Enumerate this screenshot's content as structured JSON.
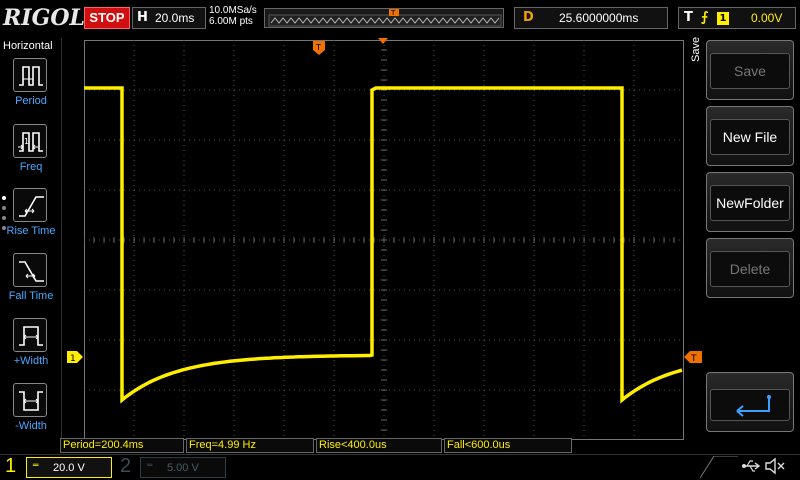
{
  "header": {
    "logo": "RIGOL",
    "run_state": "STOP",
    "timebase": {
      "key": "H",
      "value": "20.0ms"
    },
    "sample_rate": "10.0MSa/s",
    "memory_depth": "6.00M pts",
    "delay": {
      "key": "D",
      "value": "25.6000000ms"
    },
    "trigger": {
      "key": "T",
      "edge_icon": "rising-edge-icon",
      "source": "1",
      "level": "0.00V"
    }
  },
  "left_menu": {
    "title": "Horizontal",
    "items": [
      {
        "label": "Period",
        "icon": "period-icon"
      },
      {
        "label": "Freq",
        "icon": "frequency-icon"
      },
      {
        "label": "Rise Time",
        "icon": "rise-time-icon"
      },
      {
        "label": "Fall Time",
        "icon": "fall-time-icon"
      },
      {
        "label": "+Width",
        "icon": "positive-width-icon"
      },
      {
        "label": "-Width",
        "icon": "negative-width-icon"
      }
    ]
  },
  "right_menu": {
    "title": "Save",
    "buttons": [
      {
        "label": "Save",
        "enabled": false
      },
      {
        "label": "New File",
        "enabled": true
      },
      {
        "label": "NewFolder",
        "enabled": true
      },
      {
        "label": "Delete",
        "enabled": false
      }
    ],
    "return_icon": "return-arrow-icon"
  },
  "markers": {
    "trigger_position": "T",
    "channel1": "1",
    "trigger_level": "T"
  },
  "measurements": [
    {
      "text": "Period=200.4ms"
    },
    {
      "text": "Freq=4.99 Hz"
    },
    {
      "text": "Rise<400.0us"
    },
    {
      "text": "Fall<600.0us"
    }
  ],
  "channels": [
    {
      "number": "1",
      "coupling_icon": "dc-coupling-icon",
      "scale": "20.0 V",
      "active": true,
      "color": "#ffee00"
    },
    {
      "number": "2",
      "coupling_icon": "dc-coupling-icon",
      "scale": "5.00 V",
      "active": false,
      "color": "#3a4c55"
    }
  ],
  "status_icons": [
    "usb-icon",
    "speaker-muted-icon"
  ],
  "colors": {
    "trace": "#ffee00",
    "delay": "#f0a000",
    "menu_label": "#4aa8ff",
    "stop": "#d01010"
  }
}
